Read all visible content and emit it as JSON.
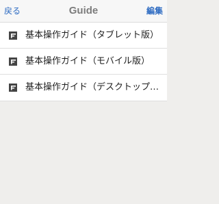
{
  "navbar": {
    "back_label": "戻る",
    "title": "Guide",
    "edit_label": "編集"
  },
  "list": {
    "items": [
      {
        "label": "基本操作ガイド（タブレット版）",
        "icon": "document-icon"
      },
      {
        "label": "基本操作ガイド（モバイル版）",
        "icon": "document-icon"
      },
      {
        "label": "基本操作ガイド（デスクトップ…",
        "icon": "document-icon"
      }
    ]
  },
  "colors": {
    "accent": "#2d6bc2",
    "background": "#efeeec",
    "navbar": "#f7f7f7",
    "title": "#7c7c7c",
    "icon": "#444444"
  }
}
